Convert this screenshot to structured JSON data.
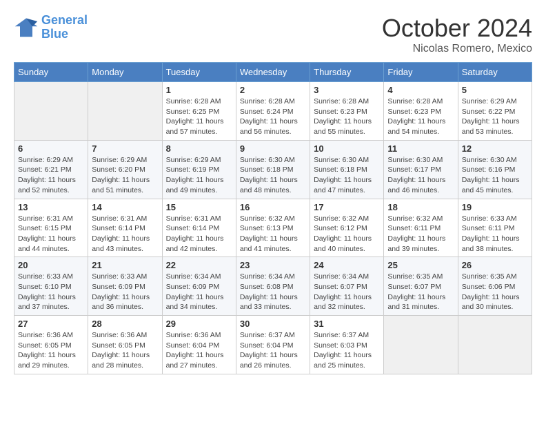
{
  "header": {
    "logo_line1": "General",
    "logo_line2": "Blue",
    "month": "October 2024",
    "location": "Nicolas Romero, Mexico"
  },
  "days_of_week": [
    "Sunday",
    "Monday",
    "Tuesday",
    "Wednesday",
    "Thursday",
    "Friday",
    "Saturday"
  ],
  "weeks": [
    [
      {
        "day": "",
        "info": ""
      },
      {
        "day": "",
        "info": ""
      },
      {
        "day": "1",
        "info": "Sunrise: 6:28 AM\nSunset: 6:25 PM\nDaylight: 11 hours and 57 minutes."
      },
      {
        "day": "2",
        "info": "Sunrise: 6:28 AM\nSunset: 6:24 PM\nDaylight: 11 hours and 56 minutes."
      },
      {
        "day": "3",
        "info": "Sunrise: 6:28 AM\nSunset: 6:23 PM\nDaylight: 11 hours and 55 minutes."
      },
      {
        "day": "4",
        "info": "Sunrise: 6:28 AM\nSunset: 6:23 PM\nDaylight: 11 hours and 54 minutes."
      },
      {
        "day": "5",
        "info": "Sunrise: 6:29 AM\nSunset: 6:22 PM\nDaylight: 11 hours and 53 minutes."
      }
    ],
    [
      {
        "day": "6",
        "info": "Sunrise: 6:29 AM\nSunset: 6:21 PM\nDaylight: 11 hours and 52 minutes."
      },
      {
        "day": "7",
        "info": "Sunrise: 6:29 AM\nSunset: 6:20 PM\nDaylight: 11 hours and 51 minutes."
      },
      {
        "day": "8",
        "info": "Sunrise: 6:29 AM\nSunset: 6:19 PM\nDaylight: 11 hours and 49 minutes."
      },
      {
        "day": "9",
        "info": "Sunrise: 6:30 AM\nSunset: 6:18 PM\nDaylight: 11 hours and 48 minutes."
      },
      {
        "day": "10",
        "info": "Sunrise: 6:30 AM\nSunset: 6:18 PM\nDaylight: 11 hours and 47 minutes."
      },
      {
        "day": "11",
        "info": "Sunrise: 6:30 AM\nSunset: 6:17 PM\nDaylight: 11 hours and 46 minutes."
      },
      {
        "day": "12",
        "info": "Sunrise: 6:30 AM\nSunset: 6:16 PM\nDaylight: 11 hours and 45 minutes."
      }
    ],
    [
      {
        "day": "13",
        "info": "Sunrise: 6:31 AM\nSunset: 6:15 PM\nDaylight: 11 hours and 44 minutes."
      },
      {
        "day": "14",
        "info": "Sunrise: 6:31 AM\nSunset: 6:14 PM\nDaylight: 11 hours and 43 minutes."
      },
      {
        "day": "15",
        "info": "Sunrise: 6:31 AM\nSunset: 6:14 PM\nDaylight: 11 hours and 42 minutes."
      },
      {
        "day": "16",
        "info": "Sunrise: 6:32 AM\nSunset: 6:13 PM\nDaylight: 11 hours and 41 minutes."
      },
      {
        "day": "17",
        "info": "Sunrise: 6:32 AM\nSunset: 6:12 PM\nDaylight: 11 hours and 40 minutes."
      },
      {
        "day": "18",
        "info": "Sunrise: 6:32 AM\nSunset: 6:11 PM\nDaylight: 11 hours and 39 minutes."
      },
      {
        "day": "19",
        "info": "Sunrise: 6:33 AM\nSunset: 6:11 PM\nDaylight: 11 hours and 38 minutes."
      }
    ],
    [
      {
        "day": "20",
        "info": "Sunrise: 6:33 AM\nSunset: 6:10 PM\nDaylight: 11 hours and 37 minutes."
      },
      {
        "day": "21",
        "info": "Sunrise: 6:33 AM\nSunset: 6:09 PM\nDaylight: 11 hours and 36 minutes."
      },
      {
        "day": "22",
        "info": "Sunrise: 6:34 AM\nSunset: 6:09 PM\nDaylight: 11 hours and 34 minutes."
      },
      {
        "day": "23",
        "info": "Sunrise: 6:34 AM\nSunset: 6:08 PM\nDaylight: 11 hours and 33 minutes."
      },
      {
        "day": "24",
        "info": "Sunrise: 6:34 AM\nSunset: 6:07 PM\nDaylight: 11 hours and 32 minutes."
      },
      {
        "day": "25",
        "info": "Sunrise: 6:35 AM\nSunset: 6:07 PM\nDaylight: 11 hours and 31 minutes."
      },
      {
        "day": "26",
        "info": "Sunrise: 6:35 AM\nSunset: 6:06 PM\nDaylight: 11 hours and 30 minutes."
      }
    ],
    [
      {
        "day": "27",
        "info": "Sunrise: 6:36 AM\nSunset: 6:05 PM\nDaylight: 11 hours and 29 minutes."
      },
      {
        "day": "28",
        "info": "Sunrise: 6:36 AM\nSunset: 6:05 PM\nDaylight: 11 hours and 28 minutes."
      },
      {
        "day": "29",
        "info": "Sunrise: 6:36 AM\nSunset: 6:04 PM\nDaylight: 11 hours and 27 minutes."
      },
      {
        "day": "30",
        "info": "Sunrise: 6:37 AM\nSunset: 6:04 PM\nDaylight: 11 hours and 26 minutes."
      },
      {
        "day": "31",
        "info": "Sunrise: 6:37 AM\nSunset: 6:03 PM\nDaylight: 11 hours and 25 minutes."
      },
      {
        "day": "",
        "info": ""
      },
      {
        "day": "",
        "info": ""
      }
    ]
  ]
}
